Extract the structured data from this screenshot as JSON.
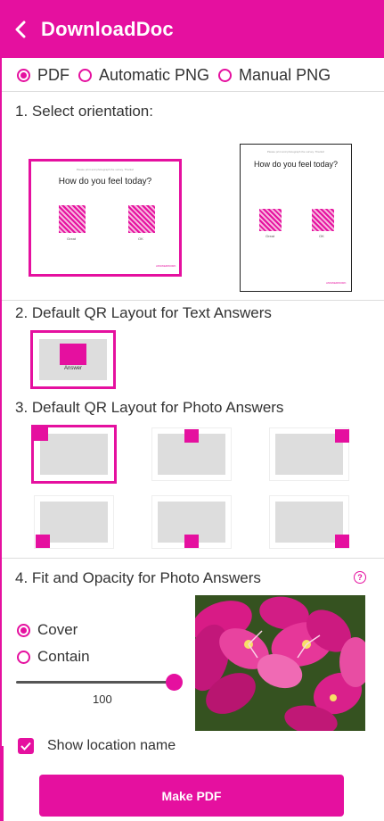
{
  "header": {
    "title": "DownloadDoc"
  },
  "format": {
    "options": [
      {
        "label": "PDF",
        "selected": true
      },
      {
        "label": "Automatic PNG",
        "selected": false
      },
      {
        "label": "Manual PNG",
        "selected": false
      }
    ]
  },
  "orientation": {
    "title": "1. Select orientation:",
    "preview": {
      "header_text": "Please print and photograph the survey. Thanks!",
      "question": "How do you feel today?",
      "answers": [
        "Great",
        "OK"
      ],
      "brand": "ANSWERWORK"
    },
    "options": [
      {
        "name": "landscape",
        "selected": true
      },
      {
        "name": "portrait",
        "selected": false
      }
    ]
  },
  "text_layout": {
    "title": "2. Default QR Layout for Text Answers",
    "answer_label": "Answer"
  },
  "photo_layout": {
    "title": "3. Default QR Layout for Photo Answers",
    "selected_index": 0
  },
  "fit": {
    "title": "4. Fit and Opacity for Photo Answers",
    "help": "?",
    "options": [
      {
        "label": "Cover",
        "selected": true
      },
      {
        "label": "Contain",
        "selected": false
      }
    ],
    "opacity_value": "100",
    "opacity_fraction": 1.0
  },
  "show_location": {
    "label": "Show location name",
    "checked": true
  },
  "make_pdf": {
    "label": "Make PDF"
  },
  "colors": {
    "accent": "#e5109f",
    "placeholder": "#dddddd"
  }
}
